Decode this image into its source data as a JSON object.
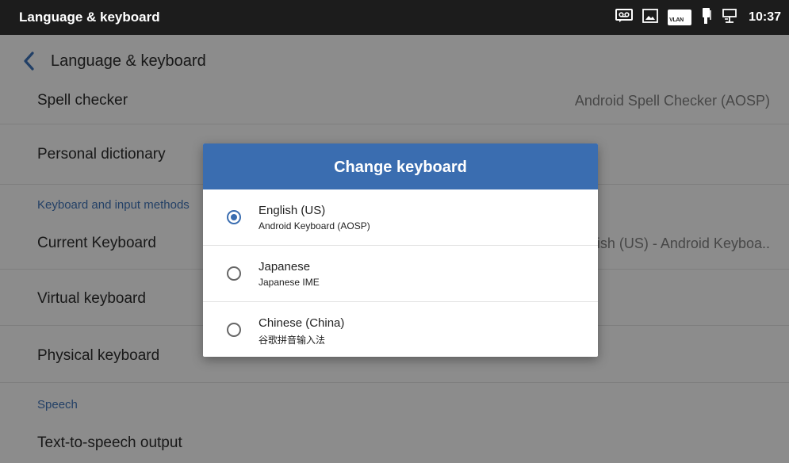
{
  "statusbar": {
    "title": "Language & keyboard",
    "icons": [
      "voicemail-icon",
      "image-icon",
      "vlan-icon",
      "handset-icon",
      "network-icon"
    ],
    "vlan_text": "VLAN",
    "time": "10:37"
  },
  "appbar": {
    "title": "Language & keyboard"
  },
  "settings": {
    "spell_checker": {
      "label": "Spell checker",
      "value": "Android Spell Checker (AOSP)"
    },
    "personal_dictionary": {
      "label": "Personal dictionary"
    },
    "keyboard_header": "Keyboard and input methods",
    "current_keyboard": {
      "label": "Current Keyboard",
      "value": "English (US) - Android Keyboa.."
    },
    "virtual_keyboard": {
      "label": "Virtual keyboard"
    },
    "physical_keyboard": {
      "label": "Physical keyboard"
    },
    "speech_header": "Speech",
    "tts": {
      "label": "Text-to-speech output"
    }
  },
  "dialog": {
    "title": "Change keyboard",
    "options": [
      {
        "name": "English (US)",
        "sub": "Android Keyboard (AOSP)",
        "selected": true
      },
      {
        "name": "Japanese",
        "sub": "Japanese IME",
        "selected": false
      },
      {
        "name": "Chinese (China)",
        "sub": "谷歌拼音输入法",
        "selected": false
      }
    ]
  },
  "colors": {
    "statusbar": "#1c1c1c",
    "accent": "#3a6db0",
    "header_text": "#3d6fb0"
  }
}
